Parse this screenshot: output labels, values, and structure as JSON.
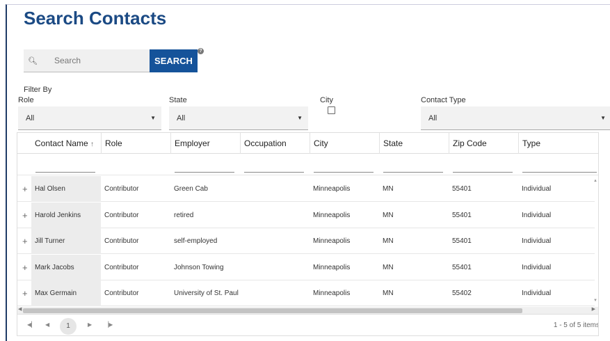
{
  "page": {
    "title": "Search Contacts"
  },
  "search": {
    "placeholder": "Search",
    "button_label": "SEARCH",
    "help_glyph": "?"
  },
  "filters": {
    "heading": "Filter By",
    "role": {
      "label": "Role",
      "value": "All"
    },
    "state": {
      "label": "State",
      "value": "All"
    },
    "city": {
      "label": "City",
      "checked": false
    },
    "contact_type": {
      "label": "Contact Type",
      "value": "All"
    }
  },
  "table": {
    "columns": [
      "Contact Name",
      "Role",
      "Employer",
      "Occupation",
      "City",
      "State",
      "Zip Code",
      "Type"
    ],
    "sort_indicator": "↑",
    "expand_glyph": "+",
    "rows": [
      [
        "Hal Olsen",
        "Contributor",
        "Green Cab",
        "",
        "Minneapolis",
        "MN",
        "55401",
        "Individual"
      ],
      [
        "Harold Jenkins",
        "Contributor",
        "retired",
        "",
        "Minneapolis",
        "MN",
        "55401",
        "Individual"
      ],
      [
        "Jill Turner",
        "Contributor",
        "self-employed",
        "",
        "Minneapolis",
        "MN",
        "55401",
        "Individual"
      ],
      [
        "Mark Jacobs",
        "Contributor",
        "Johnson Towing",
        "",
        "Minneapolis",
        "MN",
        "55401",
        "Individual"
      ],
      [
        "Max Germain",
        "Contributor",
        "University of St. Paul",
        "",
        "Minneapolis",
        "MN",
        "55402",
        "Individual"
      ]
    ]
  },
  "pager": {
    "current_page": "1",
    "info": "1 - 5 of 5 items"
  },
  "icons": {
    "search": "search-icon",
    "help": "help-icon",
    "dropdown": "chevron-down-icon",
    "expand": "plus-icon",
    "first": "first-page-icon",
    "prev": "prev-page-icon",
    "next": "next-page-icon",
    "last": "last-page-icon"
  },
  "colors": {
    "title": "#1b4a84",
    "button": "#15539a"
  }
}
